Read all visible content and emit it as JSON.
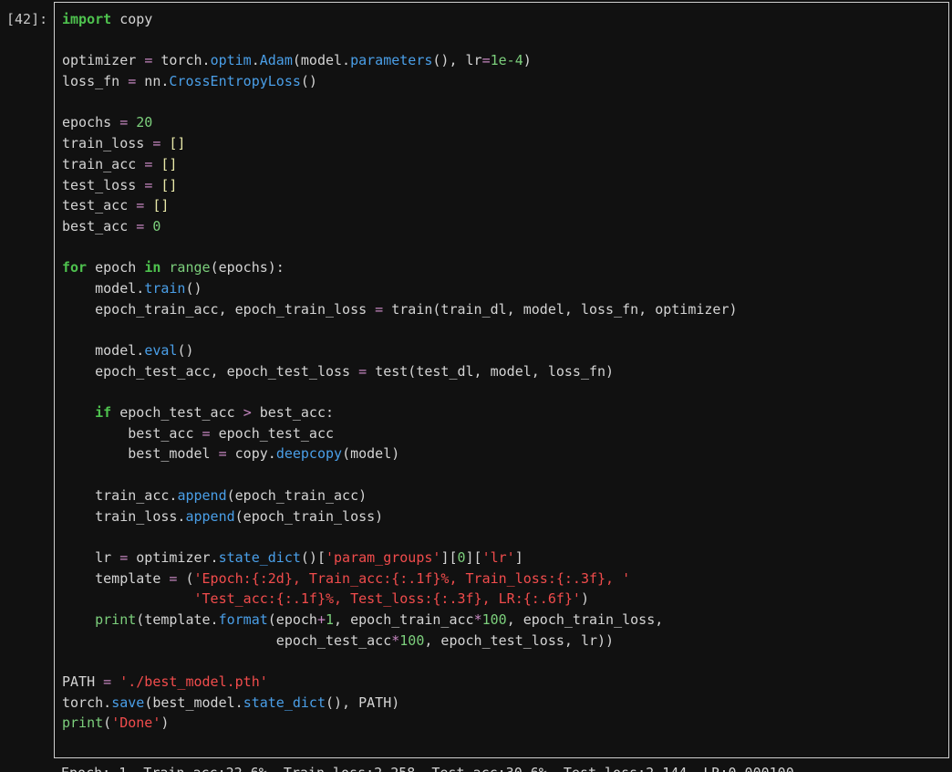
{
  "prompt": "[42]:",
  "colors": {
    "background": "#111111",
    "keyword": "#4ec24e",
    "function": "#4a9fe8",
    "number": "#7ccf7c",
    "string": "#f14c4c",
    "border": "#cfcfcf"
  },
  "code_lines": [
    [
      {
        "t": "import",
        "c": "kw"
      },
      {
        "t": " copy"
      }
    ],
    [],
    [
      {
        "t": "optimizer "
      },
      {
        "t": "=",
        "c": "op"
      },
      {
        "t": " torch."
      },
      {
        "t": "optim",
        "c": "fn"
      },
      {
        "t": "."
      },
      {
        "t": "Adam",
        "c": "fn"
      },
      {
        "t": "(model."
      },
      {
        "t": "parameters",
        "c": "fn"
      },
      {
        "t": "(), lr"
      },
      {
        "t": "=",
        "c": "op"
      },
      {
        "t": "1e-4",
        "c": "num"
      },
      {
        "t": ")"
      }
    ],
    [
      {
        "t": "loss_fn "
      },
      {
        "t": "=",
        "c": "op"
      },
      {
        "t": " nn."
      },
      {
        "t": "CrossEntropyLoss",
        "c": "fn"
      },
      {
        "t": "()"
      }
    ],
    [],
    [
      {
        "t": "epochs "
      },
      {
        "t": "=",
        "c": "op"
      },
      {
        "t": " "
      },
      {
        "t": "20",
        "c": "num"
      }
    ],
    [
      {
        "t": "train_loss "
      },
      {
        "t": "=",
        "c": "op"
      },
      {
        "t": " "
      },
      {
        "t": "[]",
        "c": "br"
      }
    ],
    [
      {
        "t": "train_acc "
      },
      {
        "t": "=",
        "c": "op"
      },
      {
        "t": " "
      },
      {
        "t": "[]",
        "c": "br"
      }
    ],
    [
      {
        "t": "test_loss "
      },
      {
        "t": "=",
        "c": "op"
      },
      {
        "t": " "
      },
      {
        "t": "[]",
        "c": "br"
      }
    ],
    [
      {
        "t": "test_acc "
      },
      {
        "t": "=",
        "c": "op"
      },
      {
        "t": " "
      },
      {
        "t": "[]",
        "c": "br"
      }
    ],
    [
      {
        "t": "best_acc "
      },
      {
        "t": "=",
        "c": "op"
      },
      {
        "t": " "
      },
      {
        "t": "0",
        "c": "num"
      }
    ],
    [],
    [
      {
        "t": "for",
        "c": "kw"
      },
      {
        "t": " epoch "
      },
      {
        "t": "in",
        "c": "kw"
      },
      {
        "t": " "
      },
      {
        "t": "range",
        "c": "num"
      },
      {
        "t": "(epochs):"
      }
    ],
    [
      {
        "t": "    model."
      },
      {
        "t": "train",
        "c": "fn"
      },
      {
        "t": "()"
      }
    ],
    [
      {
        "t": "    epoch_train_acc, epoch_train_loss "
      },
      {
        "t": "=",
        "c": "op"
      },
      {
        "t": " train(train_dl, model, loss_fn, optimizer)"
      }
    ],
    [],
    [
      {
        "t": "    model."
      },
      {
        "t": "eval",
        "c": "fn"
      },
      {
        "t": "()"
      }
    ],
    [
      {
        "t": "    epoch_test_acc, epoch_test_loss "
      },
      {
        "t": "=",
        "c": "op"
      },
      {
        "t": " test(test_dl, model, loss_fn)"
      }
    ],
    [],
    [
      {
        "t": "    "
      },
      {
        "t": "if",
        "c": "kw"
      },
      {
        "t": " epoch_test_acc "
      },
      {
        "t": ">",
        "c": "op"
      },
      {
        "t": " best_acc:"
      }
    ],
    [
      {
        "t": "        best_acc "
      },
      {
        "t": "=",
        "c": "op"
      },
      {
        "t": " epoch_test_acc"
      }
    ],
    [
      {
        "t": "        best_model "
      },
      {
        "t": "=",
        "c": "op"
      },
      {
        "t": " copy."
      },
      {
        "t": "deepcopy",
        "c": "fn"
      },
      {
        "t": "(model)"
      }
    ],
    [],
    [
      {
        "t": "    train_acc."
      },
      {
        "t": "append",
        "c": "fn"
      },
      {
        "t": "(epoch_train_acc)"
      }
    ],
    [
      {
        "t": "    train_loss."
      },
      {
        "t": "append",
        "c": "fn"
      },
      {
        "t": "(epoch_train_loss)"
      }
    ],
    [],
    [
      {
        "t": "    lr "
      },
      {
        "t": "=",
        "c": "op"
      },
      {
        "t": " optimizer."
      },
      {
        "t": "state_dict",
        "c": "fn"
      },
      {
        "t": "()["
      },
      {
        "t": "'param_groups'",
        "c": "str"
      },
      {
        "t": "]["
      },
      {
        "t": "0",
        "c": "num"
      },
      {
        "t": "]["
      },
      {
        "t": "'lr'",
        "c": "str"
      },
      {
        "t": "]"
      }
    ],
    [
      {
        "t": "    template "
      },
      {
        "t": "=",
        "c": "op"
      },
      {
        "t": " ("
      },
      {
        "t": "'Epoch:{:2d}, Train_acc:{:.1f}%, Train_loss:{:.3f}, '",
        "c": "str"
      }
    ],
    [
      {
        "t": "                "
      },
      {
        "t": "'Test_acc:{:.1f}%, Test_loss:{:.3f}, LR:{:.6f}'",
        "c": "str"
      },
      {
        "t": ")"
      }
    ],
    [
      {
        "t": "    "
      },
      {
        "t": "print",
        "c": "num"
      },
      {
        "t": "(template."
      },
      {
        "t": "format",
        "c": "fn"
      },
      {
        "t": "(epoch"
      },
      {
        "t": "+",
        "c": "op"
      },
      {
        "t": "1",
        "c": "num"
      },
      {
        "t": ", epoch_train_acc"
      },
      {
        "t": "*",
        "c": "op"
      },
      {
        "t": "100",
        "c": "num"
      },
      {
        "t": ", epoch_train_loss,"
      }
    ],
    [
      {
        "t": "                          epoch_test_acc"
      },
      {
        "t": "*",
        "c": "op"
      },
      {
        "t": "100",
        "c": "num"
      },
      {
        "t": ", epoch_test_loss, lr))"
      }
    ],
    [],
    [
      {
        "t": "PATH "
      },
      {
        "t": "=",
        "c": "op"
      },
      {
        "t": " "
      },
      {
        "t": "'./best_model.pth'",
        "c": "str"
      }
    ],
    [
      {
        "t": "torch."
      },
      {
        "t": "save",
        "c": "fn"
      },
      {
        "t": "(best_model."
      },
      {
        "t": "state_dict",
        "c": "fn"
      },
      {
        "t": "(), PATH)"
      }
    ],
    [
      {
        "t": "print",
        "c": "num"
      },
      {
        "t": "("
      },
      {
        "t": "'Done'",
        "c": "str"
      },
      {
        "t": ")"
      }
    ]
  ],
  "output_partial": "Epoch: 1, Train_acc:22.6%, Train_loss:2.258, Test_acc:30.6%, Test_loss:2.144, LR:0.000100"
}
